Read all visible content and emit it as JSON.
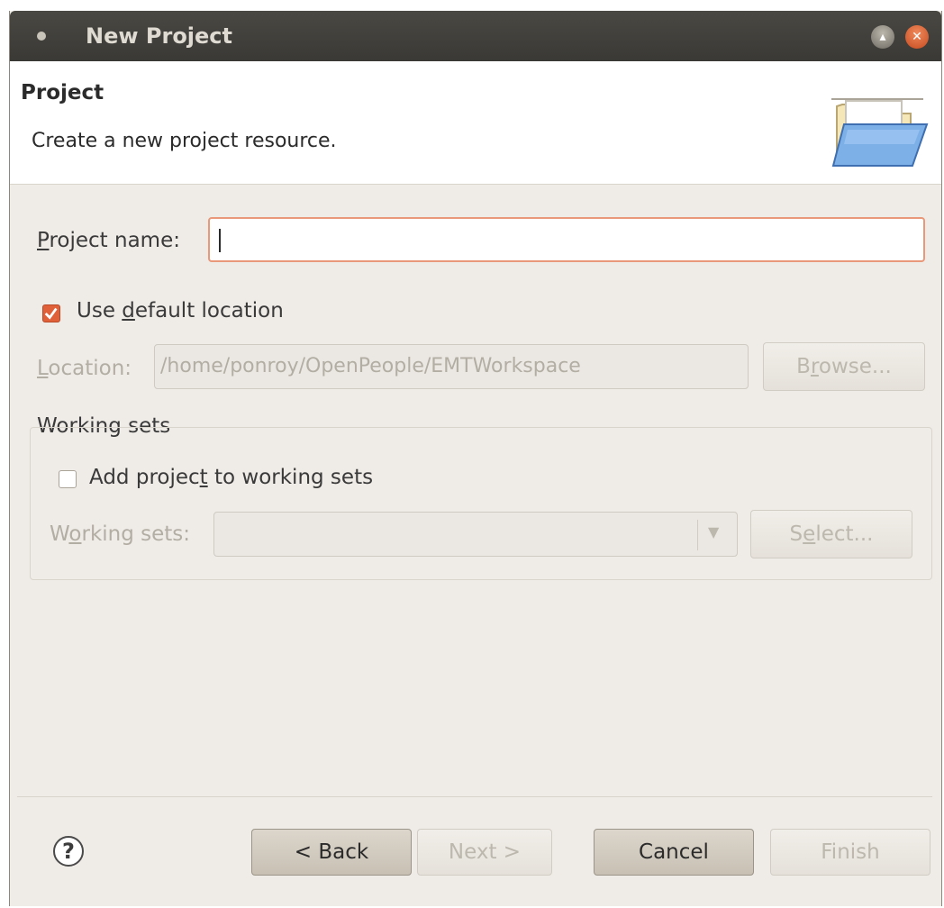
{
  "window": {
    "title": "New Project"
  },
  "header": {
    "heading": "Project",
    "description": "Create a new project resource."
  },
  "project_name": {
    "label_prefix": "",
    "label_mnemonic": "P",
    "label_rest": "roject name:",
    "value": ""
  },
  "use_default_location": {
    "label_pre": "Use ",
    "label_mnemonic": "d",
    "label_rest": "efault location",
    "checked": true
  },
  "location": {
    "label_mnemonic": "L",
    "label_rest": "ocation:",
    "value": "/home/ponroy/OpenPeople/EMTWorkspace",
    "browse_pre": "B",
    "browse_mnemonic": "r",
    "browse_rest": "owse..."
  },
  "working_sets_group": {
    "title": "Working sets",
    "add_pre": "Add projec",
    "add_mnemonic": "t",
    "add_rest": " to working sets",
    "add_checked": false,
    "sets_pre": "W",
    "sets_mnemonic": "o",
    "sets_rest": "rking sets:",
    "sets_value": "",
    "select_pre": "S",
    "select_mnemonic": "e",
    "select_rest": "lect..."
  },
  "footer": {
    "help": "?",
    "back": "< Back",
    "next": "Next >",
    "cancel": "Cancel",
    "finish": "Finish"
  },
  "icons": {
    "menu": "window-menu-icon",
    "maximize": "maximize-icon",
    "close": "close-icon",
    "folder": "folder-open-icon",
    "help": "help-icon",
    "check": "checkmark-icon",
    "dropdown": "dropdown-arrow-icon"
  },
  "colors": {
    "accent": "#e0603a",
    "titlebar": "#3c3b37",
    "dialog_bg": "#efebe7"
  }
}
